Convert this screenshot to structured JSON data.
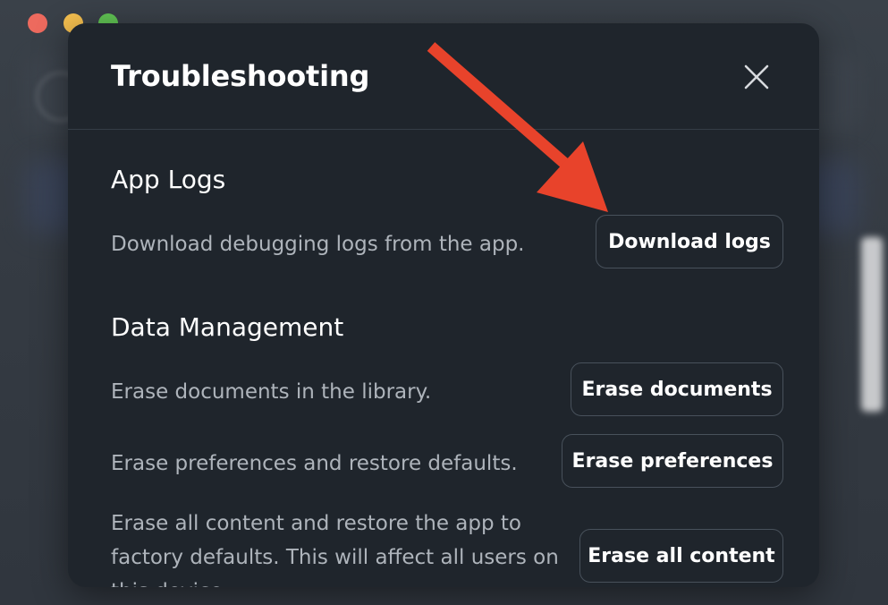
{
  "dialog": {
    "title": "Troubleshooting",
    "close_icon": "close-icon"
  },
  "sections": {
    "app_logs": {
      "title": "App Logs",
      "rows": [
        {
          "description": "Download debugging logs from the app.",
          "button": "Download logs"
        }
      ]
    },
    "data_management": {
      "title": "Data Management",
      "rows": [
        {
          "description": "Erase documents in the library.",
          "button": "Erase documents"
        },
        {
          "description": "Erase preferences and restore defaults.",
          "button": "Erase preferences"
        },
        {
          "description_line1": "Erase all content and restore the app to",
          "description_line2": "factory defaults. This will affect all users on",
          "description_line3": "this device.",
          "button": "Erase all content"
        }
      ]
    }
  },
  "annotation": {
    "arrow_color": "#e8432b",
    "arrow_icon": "arrow-pointer-icon"
  },
  "colors": {
    "dialog_bg": "#1f252c",
    "description_text": "#aeb4bb",
    "button_border": "#48515b"
  }
}
